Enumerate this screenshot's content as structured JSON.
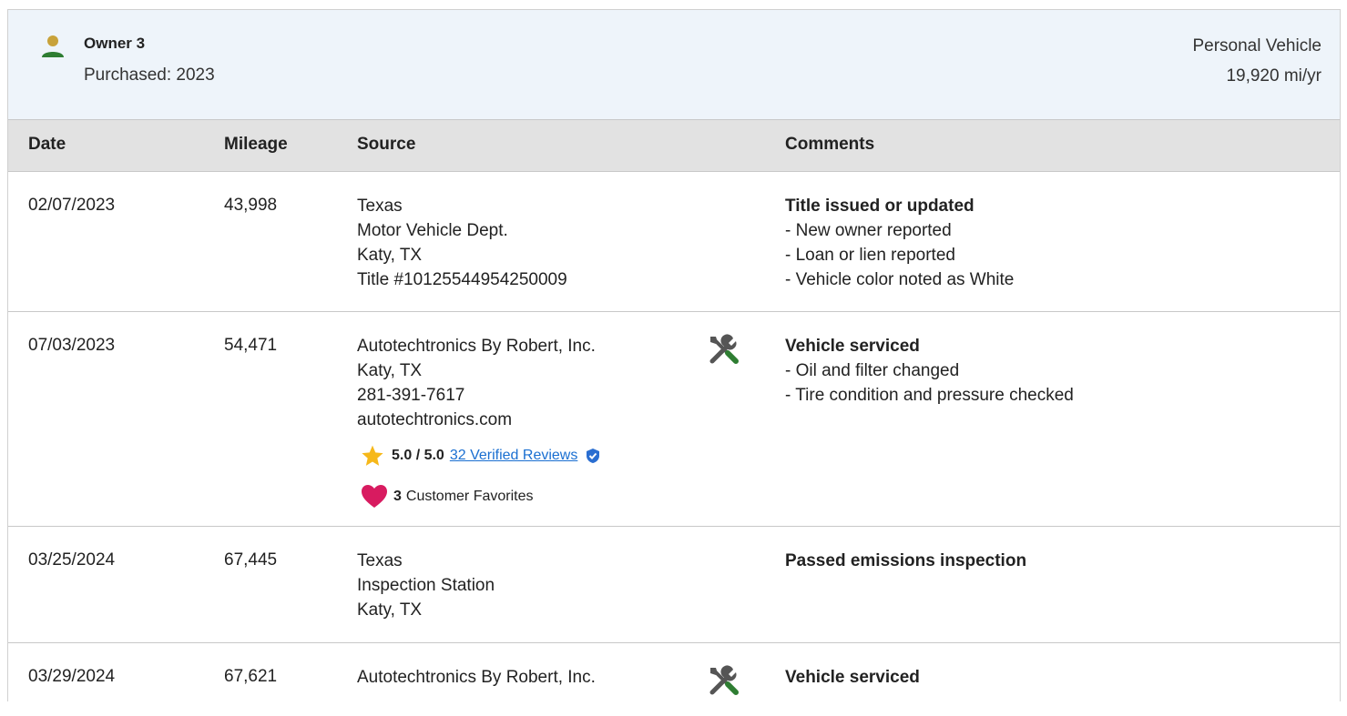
{
  "owner": {
    "name": "Owner 3",
    "purchased": "Purchased: 2023",
    "use_type": "Personal Vehicle",
    "mileage_per_year": "19,920 mi/yr",
    "icon": "person-icon"
  },
  "table": {
    "headers": [
      "Date",
      "Mileage",
      "Source",
      "Comments"
    ],
    "rows": [
      {
        "date": "02/07/2023",
        "mileage": "43,998",
        "source": [
          "Texas",
          "Motor Vehicle Dept.",
          "Katy, TX",
          "Title #10125544954250009"
        ],
        "comment_title": "Title issued or updated",
        "comments": [
          "- New owner reported",
          "- Loan or lien reported",
          "- Vehicle color noted as White"
        ]
      },
      {
        "date": "07/03/2023",
        "mileage": "54,471",
        "source": [
          "Autotechtronics By Robert, Inc.",
          "Katy, TX",
          "281-391-7617",
          "autotechtronics.com"
        ],
        "icon": "service-tools-icon",
        "rating": {
          "score": "5.0 / 5.0",
          "reviews": "32 Verified Reviews",
          "favorites_count": "3",
          "favorites_label": "Customer Favorites"
        },
        "comment_title": "Vehicle serviced",
        "comments": [
          "- Oil and filter changed",
          "- Tire condition and pressure checked"
        ]
      },
      {
        "date": "03/25/2024",
        "mileage": "67,445",
        "source": [
          "Texas",
          "Inspection Station",
          "Katy, TX"
        ],
        "comment_title": "Passed emissions inspection",
        "comments": []
      },
      {
        "date": "03/29/2024",
        "mileage": "67,621",
        "source": [
          "Autotechtronics By Robert, Inc."
        ],
        "icon": "service-tools-icon",
        "comment_title": "Vehicle serviced",
        "comments": []
      }
    ]
  },
  "colors": {
    "header_bg": "#eef4fa",
    "table_head_bg": "#e2e2e2",
    "link": "#1a6fd1",
    "icon_green": "#2e7d32",
    "icon_gray": "#555555",
    "star": "#f6b81a",
    "heart": "#d81b60",
    "person_head": "#c8a23a"
  }
}
